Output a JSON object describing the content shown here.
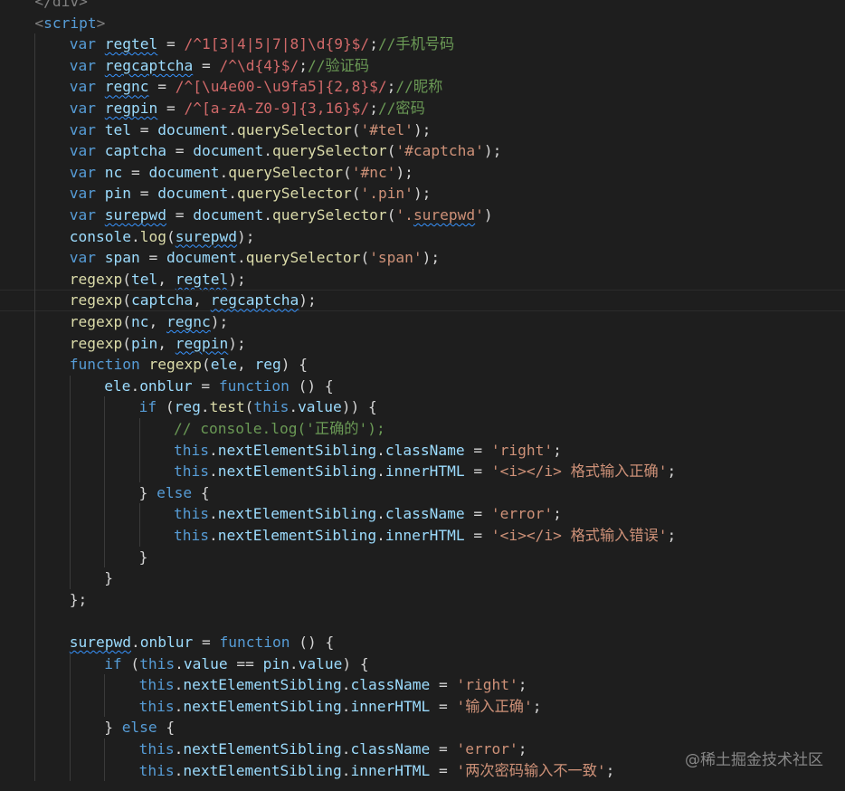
{
  "editor": {
    "theme": {
      "background": "#1e1e1e",
      "keyword": "#569cd6",
      "variable": "#9cdcfe",
      "function": "#dcdcaa",
      "string": "#ce9178",
      "regex": "#d16969",
      "comment": "#6a9955",
      "punctuation": "#808080",
      "plain": "#d4d4d4",
      "squiggle": "#3794ff"
    },
    "lines": [
      {
        "indent": 1,
        "tokens": [
          [
            "tag",
            "</div>"
          ]
        ]
      },
      {
        "indent": 1,
        "tokens": [
          [
            "tag",
            "<"
          ],
          [
            "kw",
            "script"
          ],
          [
            "tag",
            ">"
          ]
        ]
      },
      {
        "indent": 2,
        "tokens": [
          [
            "kw",
            "var "
          ],
          [
            "var",
            "regtel",
            "s"
          ],
          [
            "plain",
            " = "
          ],
          [
            "regex",
            "/^1[3|4|5|7|8]\\d{9}$/"
          ],
          [
            "plain",
            ";"
          ],
          [
            "cmt",
            "//手机号码"
          ]
        ]
      },
      {
        "indent": 2,
        "tokens": [
          [
            "kw",
            "var "
          ],
          [
            "var",
            "regcaptcha",
            "s"
          ],
          [
            "plain",
            " = "
          ],
          [
            "regex",
            "/^\\d{4}$/"
          ],
          [
            "plain",
            ";"
          ],
          [
            "cmt",
            "//验证码"
          ]
        ]
      },
      {
        "indent": 2,
        "tokens": [
          [
            "kw",
            "var "
          ],
          [
            "var",
            "regnc",
            "s"
          ],
          [
            "plain",
            " = "
          ],
          [
            "regex",
            "/^[\\u4e00-\\u9fa5]{2,8}$/"
          ],
          [
            "plain",
            ";"
          ],
          [
            "cmt",
            "//昵称"
          ]
        ]
      },
      {
        "indent": 2,
        "tokens": [
          [
            "kw",
            "var "
          ],
          [
            "var",
            "regpin",
            "s"
          ],
          [
            "plain",
            " = "
          ],
          [
            "regex",
            "/^[a-zA-Z0-9]{3,16}$/"
          ],
          [
            "plain",
            ";"
          ],
          [
            "cmt",
            "//密码"
          ]
        ]
      },
      {
        "indent": 2,
        "tokens": [
          [
            "kw",
            "var "
          ],
          [
            "var",
            "tel"
          ],
          [
            "plain",
            " = "
          ],
          [
            "var",
            "document"
          ],
          [
            "plain",
            "."
          ],
          [
            "fn",
            "querySelector"
          ],
          [
            "plain",
            "("
          ],
          [
            "str",
            "'#tel'"
          ],
          [
            "plain",
            ");"
          ]
        ]
      },
      {
        "indent": 2,
        "tokens": [
          [
            "kw",
            "var "
          ],
          [
            "var",
            "captcha"
          ],
          [
            "plain",
            " = "
          ],
          [
            "var",
            "document"
          ],
          [
            "plain",
            "."
          ],
          [
            "fn",
            "querySelector"
          ],
          [
            "plain",
            "("
          ],
          [
            "str",
            "'#captcha'"
          ],
          [
            "plain",
            ");"
          ]
        ]
      },
      {
        "indent": 2,
        "tokens": [
          [
            "kw",
            "var "
          ],
          [
            "var",
            "nc"
          ],
          [
            "plain",
            " = "
          ],
          [
            "var",
            "document"
          ],
          [
            "plain",
            "."
          ],
          [
            "fn",
            "querySelector"
          ],
          [
            "plain",
            "("
          ],
          [
            "str",
            "'#nc'"
          ],
          [
            "plain",
            ");"
          ]
        ]
      },
      {
        "indent": 2,
        "tokens": [
          [
            "kw",
            "var "
          ],
          [
            "var",
            "pin"
          ],
          [
            "plain",
            " = "
          ],
          [
            "var",
            "document"
          ],
          [
            "plain",
            "."
          ],
          [
            "fn",
            "querySelector"
          ],
          [
            "plain",
            "("
          ],
          [
            "str",
            "'.pin'"
          ],
          [
            "plain",
            ");"
          ]
        ]
      },
      {
        "indent": 2,
        "tokens": [
          [
            "kw",
            "var "
          ],
          [
            "var",
            "surepwd",
            "s"
          ],
          [
            "plain",
            " = "
          ],
          [
            "var",
            "document"
          ],
          [
            "plain",
            "."
          ],
          [
            "fn",
            "querySelector"
          ],
          [
            "plain",
            "("
          ],
          [
            "str",
            "'."
          ],
          [
            "str",
            "surepwd",
            "s"
          ],
          [
            "str",
            "'"
          ],
          [
            "plain",
            ")"
          ]
        ]
      },
      {
        "indent": 2,
        "tokens": [
          [
            "var",
            "console"
          ],
          [
            "plain",
            "."
          ],
          [
            "fn",
            "log"
          ],
          [
            "plain",
            "("
          ],
          [
            "var",
            "surepwd",
            "s"
          ],
          [
            "plain",
            ");"
          ]
        ]
      },
      {
        "indent": 2,
        "tokens": [
          [
            "kw",
            "var "
          ],
          [
            "var",
            "span"
          ],
          [
            "plain",
            " = "
          ],
          [
            "var",
            "document"
          ],
          [
            "plain",
            "."
          ],
          [
            "fn",
            "querySelector"
          ],
          [
            "plain",
            "("
          ],
          [
            "str",
            "'span'"
          ],
          [
            "plain",
            ");"
          ]
        ]
      },
      {
        "indent": 2,
        "tokens": [
          [
            "fn",
            "regexp"
          ],
          [
            "plain",
            "("
          ],
          [
            "var",
            "tel"
          ],
          [
            "plain",
            ", "
          ],
          [
            "var",
            "regtel",
            "s"
          ],
          [
            "plain",
            ");"
          ]
        ]
      },
      {
        "indent": 2,
        "current": true,
        "tokens": [
          [
            "fn",
            "regexp"
          ],
          [
            "plain",
            "("
          ],
          [
            "var",
            "captcha"
          ],
          [
            "plain",
            ", "
          ],
          [
            "var",
            "regcaptcha",
            "s"
          ],
          [
            "plain",
            ");"
          ]
        ]
      },
      {
        "indent": 2,
        "tokens": [
          [
            "fn",
            "regexp"
          ],
          [
            "plain",
            "("
          ],
          [
            "var",
            "nc"
          ],
          [
            "plain",
            ", "
          ],
          [
            "var",
            "regnc",
            "s"
          ],
          [
            "plain",
            ");"
          ]
        ]
      },
      {
        "indent": 2,
        "tokens": [
          [
            "fn",
            "regexp"
          ],
          [
            "plain",
            "("
          ],
          [
            "var",
            "pin"
          ],
          [
            "plain",
            ", "
          ],
          [
            "var",
            "regpin",
            "s"
          ],
          [
            "plain",
            ");"
          ]
        ]
      },
      {
        "indent": 2,
        "tokens": [
          [
            "kw",
            "function "
          ],
          [
            "fn",
            "regexp"
          ],
          [
            "plain",
            "("
          ],
          [
            "var",
            "ele"
          ],
          [
            "plain",
            ", "
          ],
          [
            "var",
            "reg"
          ],
          [
            "plain",
            ") {"
          ]
        ]
      },
      {
        "indent": 3,
        "tokens": [
          [
            "var",
            "ele"
          ],
          [
            "plain",
            "."
          ],
          [
            "var",
            "onblur"
          ],
          [
            "plain",
            " = "
          ],
          [
            "kw",
            "function"
          ],
          [
            "plain",
            " () {"
          ]
        ]
      },
      {
        "indent": 4,
        "tokens": [
          [
            "kw",
            "if"
          ],
          [
            "plain",
            " ("
          ],
          [
            "var",
            "reg"
          ],
          [
            "plain",
            "."
          ],
          [
            "fn",
            "test"
          ],
          [
            "plain",
            "("
          ],
          [
            "kw",
            "this"
          ],
          [
            "plain",
            "."
          ],
          [
            "var",
            "value"
          ],
          [
            "plain",
            ")) {"
          ]
        ]
      },
      {
        "indent": 5,
        "tokens": [
          [
            "cmt",
            "// console.log('正确的');"
          ]
        ]
      },
      {
        "indent": 5,
        "tokens": [
          [
            "kw",
            "this"
          ],
          [
            "plain",
            "."
          ],
          [
            "var",
            "nextElementSibling"
          ],
          [
            "plain",
            "."
          ],
          [
            "var",
            "className"
          ],
          [
            "plain",
            " = "
          ],
          [
            "str",
            "'right'"
          ],
          [
            "plain",
            ";"
          ]
        ]
      },
      {
        "indent": 5,
        "tokens": [
          [
            "kw",
            "this"
          ],
          [
            "plain",
            "."
          ],
          [
            "var",
            "nextElementSibling"
          ],
          [
            "plain",
            "."
          ],
          [
            "var",
            "innerHTML"
          ],
          [
            "plain",
            " = "
          ],
          [
            "str",
            "'<i></i> 格式输入正确'"
          ],
          [
            "plain",
            ";"
          ]
        ]
      },
      {
        "indent": 4,
        "tokens": [
          [
            "plain",
            "} "
          ],
          [
            "kw",
            "else"
          ],
          [
            "plain",
            " {"
          ]
        ]
      },
      {
        "indent": 5,
        "tokens": [
          [
            "kw",
            "this"
          ],
          [
            "plain",
            "."
          ],
          [
            "var",
            "nextElementSibling"
          ],
          [
            "plain",
            "."
          ],
          [
            "var",
            "className"
          ],
          [
            "plain",
            " = "
          ],
          [
            "str",
            "'error'"
          ],
          [
            "plain",
            ";"
          ]
        ]
      },
      {
        "indent": 5,
        "tokens": [
          [
            "kw",
            "this"
          ],
          [
            "plain",
            "."
          ],
          [
            "var",
            "nextElementSibling"
          ],
          [
            "plain",
            "."
          ],
          [
            "var",
            "innerHTML"
          ],
          [
            "plain",
            " = "
          ],
          [
            "str",
            "'<i></i> 格式输入错误'"
          ],
          [
            "plain",
            ";"
          ]
        ]
      },
      {
        "indent": 4,
        "tokens": [
          [
            "plain",
            "}"
          ]
        ]
      },
      {
        "indent": 3,
        "tokens": [
          [
            "plain",
            "}"
          ]
        ]
      },
      {
        "indent": 2,
        "tokens": [
          [
            "plain",
            "};"
          ]
        ]
      },
      {
        "indent": 2,
        "tokens": []
      },
      {
        "indent": 2,
        "tokens": [
          [
            "var",
            "surepwd",
            "s"
          ],
          [
            "plain",
            "."
          ],
          [
            "var",
            "onblur"
          ],
          [
            "plain",
            " = "
          ],
          [
            "kw",
            "function"
          ],
          [
            "plain",
            " () {"
          ]
        ]
      },
      {
        "indent": 3,
        "tokens": [
          [
            "kw",
            "if"
          ],
          [
            "plain",
            " ("
          ],
          [
            "kw",
            "this"
          ],
          [
            "plain",
            "."
          ],
          [
            "var",
            "value"
          ],
          [
            "plain",
            " == "
          ],
          [
            "var",
            "pin"
          ],
          [
            "plain",
            "."
          ],
          [
            "var",
            "value"
          ],
          [
            "plain",
            ") {"
          ]
        ]
      },
      {
        "indent": 4,
        "tokens": [
          [
            "kw",
            "this"
          ],
          [
            "plain",
            "."
          ],
          [
            "var",
            "nextElementSibling"
          ],
          [
            "plain",
            "."
          ],
          [
            "var",
            "className"
          ],
          [
            "plain",
            " = "
          ],
          [
            "str",
            "'right'"
          ],
          [
            "plain",
            ";"
          ]
        ]
      },
      {
        "indent": 4,
        "tokens": [
          [
            "kw",
            "this"
          ],
          [
            "plain",
            "."
          ],
          [
            "var",
            "nextElementSibling"
          ],
          [
            "plain",
            "."
          ],
          [
            "var",
            "innerHTML"
          ],
          [
            "plain",
            " = "
          ],
          [
            "str",
            "'输入正确'"
          ],
          [
            "plain",
            ";"
          ]
        ]
      },
      {
        "indent": 3,
        "tokens": [
          [
            "plain",
            "} "
          ],
          [
            "kw",
            "else"
          ],
          [
            "plain",
            " {"
          ]
        ]
      },
      {
        "indent": 4,
        "tokens": [
          [
            "kw",
            "this"
          ],
          [
            "plain",
            "."
          ],
          [
            "var",
            "nextElementSibling"
          ],
          [
            "plain",
            "."
          ],
          [
            "var",
            "className"
          ],
          [
            "plain",
            " = "
          ],
          [
            "str",
            "'error'"
          ],
          [
            "plain",
            ";"
          ]
        ]
      },
      {
        "indent": 4,
        "tokens": [
          [
            "kw",
            "this"
          ],
          [
            "plain",
            "."
          ],
          [
            "var",
            "nextElementSibling"
          ],
          [
            "plain",
            "."
          ],
          [
            "var",
            "innerHTML"
          ],
          [
            "plain",
            " = "
          ],
          [
            "str",
            "'两次密码输入不一致'"
          ],
          [
            "plain",
            ";"
          ]
        ]
      }
    ]
  },
  "watermark": {
    "text": "@稀土掘金技术社区"
  }
}
